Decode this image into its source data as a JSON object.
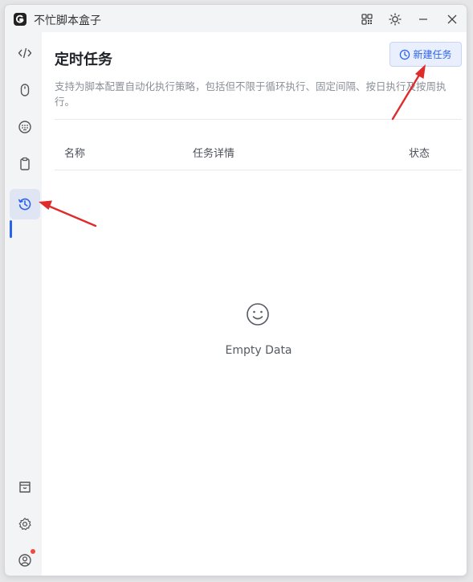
{
  "app": {
    "title": "不忙脚本盒子"
  },
  "page": {
    "title": "定时任务",
    "new_task_label": "新建任务",
    "description": "支持为脚本配置自动化执行策略，包括但不限于循环执行、固定间隔、按日执行及按周执行。"
  },
  "table": {
    "columns": [
      "名称",
      "任务详情",
      "状态"
    ]
  },
  "empty": {
    "text": "Empty Data"
  },
  "sidebar": {
    "items": [
      {
        "icon": "code-icon"
      },
      {
        "icon": "mouse-icon"
      },
      {
        "icon": "keyboard-icon"
      },
      {
        "icon": "clipboard-icon"
      },
      {
        "icon": "history-clock-icon",
        "active": true
      }
    ],
    "bottom": [
      {
        "icon": "store-icon"
      },
      {
        "icon": "gear-icon"
      },
      {
        "icon": "user-icon",
        "has_notification": true
      }
    ]
  },
  "colors": {
    "accent": "#2a63f0",
    "annotation_arrow": "#e02b2b",
    "notification": "#f04b3f"
  }
}
